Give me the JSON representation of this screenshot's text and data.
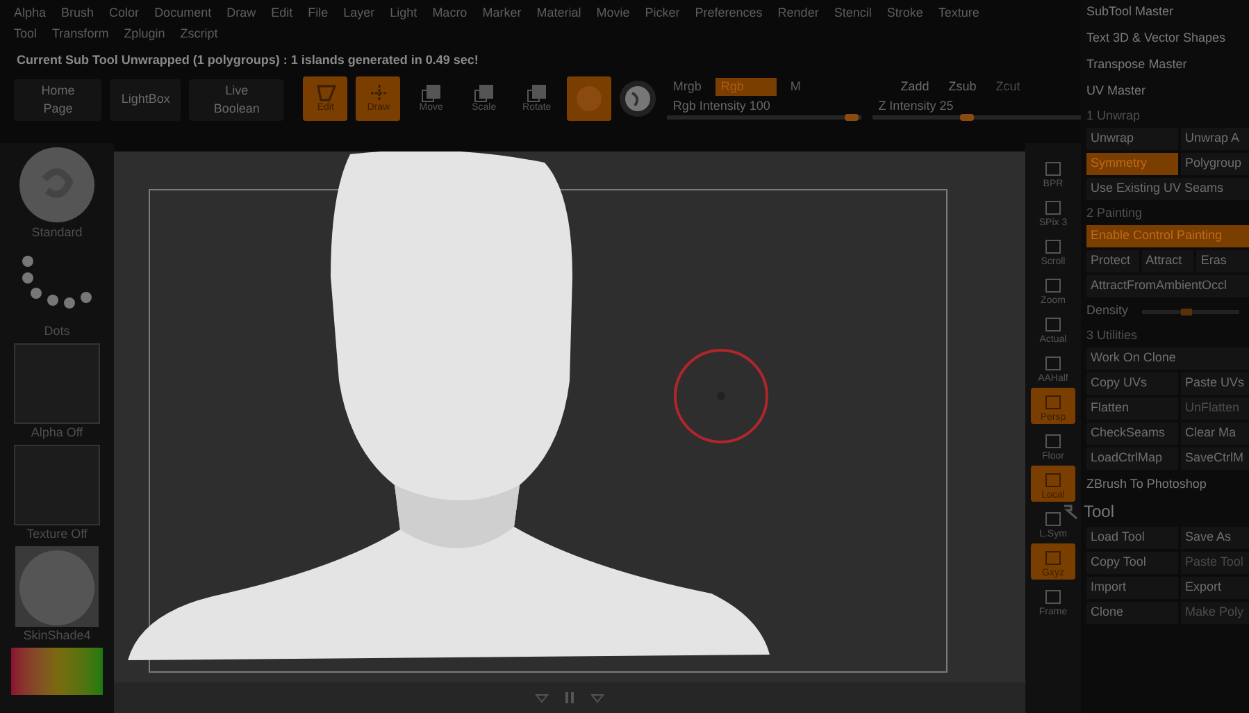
{
  "menu_rows": [
    [
      "Alpha",
      "Brush",
      "Color",
      "Document",
      "Draw",
      "Edit",
      "File",
      "Layer",
      "Light",
      "Macro",
      "Marker",
      "Material",
      "Movie",
      "Picker",
      "Preferences",
      "Render",
      "Stencil",
      "Stroke",
      "Texture"
    ],
    [
      "Tool",
      "Transform",
      "Zplugin",
      "Zscript"
    ]
  ],
  "status_message": "Current Sub Tool Unwrapped (1 polygroups) :  1 islands generated in 0.49 sec!",
  "toolbar": {
    "nav": [
      "Home Page",
      "LightBox",
      "Live Boolean"
    ],
    "tools": [
      {
        "kind": "edit",
        "label": "Edit",
        "selected": true
      },
      {
        "kind": "draw",
        "label": "Draw",
        "selected": true
      },
      {
        "kind": "move",
        "label": "Move",
        "selected": false
      },
      {
        "kind": "scale",
        "label": "Scale",
        "selected": false
      },
      {
        "kind": "rotate",
        "label": "Rotate",
        "selected": false
      },
      {
        "kind": "orb",
        "selected": true
      },
      {
        "kind": "sphere",
        "selected": false
      }
    ],
    "color_modes": [
      {
        "label": "Mrgb",
        "selected": false
      },
      {
        "label": "Rgb",
        "selected": true
      },
      {
        "label": "M",
        "selected": false
      }
    ],
    "z_modes": [
      {
        "label": "Zadd",
        "disabled": false
      },
      {
        "label": "Zsub",
        "disabled": false
      },
      {
        "label": "Zcut",
        "disabled": true
      }
    ],
    "rgb_intensity": {
      "label": "Rgb Intensity 100",
      "level": 0.95
    },
    "z_intensity": {
      "label": "Z Intensity 25",
      "level": 0.45
    }
  },
  "left_shelf": [
    {
      "kind": "brush",
      "label": "Standard"
    },
    {
      "kind": "stroke",
      "label": "Dots"
    },
    {
      "kind": "alpha",
      "label": "Alpha Off"
    },
    {
      "kind": "texture",
      "label": "Texture Off"
    },
    {
      "kind": "material",
      "label": "SkinShade4"
    },
    {
      "kind": "color"
    }
  ],
  "right_strip": [
    {
      "label": "BPR",
      "selected": false
    },
    {
      "label": "SPix 3",
      "selected": false
    },
    {
      "label": "Scroll",
      "selected": false
    },
    {
      "label": "Zoom",
      "selected": false
    },
    {
      "label": "Actual",
      "selected": false
    },
    {
      "label": "AAHalf",
      "selected": false
    },
    {
      "label": "Persp",
      "selected": true
    },
    {
      "label": "Floor",
      "selected": false
    },
    {
      "label": "Local",
      "selected": true
    },
    {
      "label": "L.Sym",
      "selected": false
    },
    {
      "label": "Gxyz",
      "selected": true
    },
    {
      "label": "Frame",
      "selected": false
    }
  ],
  "right_panel": [
    {
      "kind": "plain",
      "label": "SubTool Master"
    },
    {
      "kind": "plain",
      "label": "Text 3D & Vector Shapes"
    },
    {
      "kind": "plain",
      "label": "Transpose Master"
    },
    {
      "kind": "plain",
      "label": "UV Master"
    },
    {
      "kind": "header",
      "label": "1 Unwrap"
    },
    {
      "kind": "buttons",
      "buttons": [
        {
          "label": "Unwrap",
          "selected": false,
          "disabled": false
        },
        {
          "label": "Unwrap A",
          "selected": false,
          "disabled": false
        }
      ]
    },
    {
      "kind": "buttons",
      "buttons": [
        {
          "label": "Symmetry",
          "selected": true,
          "disabled": false
        },
        {
          "label": "Polygroup",
          "selected": false,
          "disabled": false
        }
      ]
    },
    {
      "kind": "buttons",
      "buttons": [
        {
          "label": "Use Existing UV Seams",
          "selected": false,
          "disabled": false
        }
      ]
    },
    {
      "kind": "header",
      "label": "2 Painting"
    },
    {
      "kind": "buttons",
      "buttons": [
        {
          "label": "Enable Control Painting",
          "selected": true,
          "disabled": false
        }
      ]
    },
    {
      "kind": "buttons",
      "buttons": [
        {
          "label": "Protect",
          "selected": false,
          "disabled": false
        },
        {
          "label": "Attract",
          "selected": false,
          "disabled": false
        },
        {
          "label": "Eras",
          "selected": false,
          "disabled": false
        }
      ]
    },
    {
      "kind": "buttons",
      "buttons": [
        {
          "label": "AttractFromAmbientOccl",
          "selected": false,
          "disabled": false
        }
      ]
    },
    {
      "kind": "slider",
      "label": "Density",
      "level": 0.45
    },
    {
      "kind": "header",
      "label": "3 Utilities"
    },
    {
      "kind": "buttons",
      "buttons": [
        {
          "label": "Work On Clone",
          "selected": false,
          "disabled": false
        }
      ]
    },
    {
      "kind": "buttons",
      "buttons": [
        {
          "label": "Copy UVs",
          "selected": false,
          "disabled": false
        },
        {
          "label": "Paste UVs",
          "selected": false,
          "disabled": false
        }
      ]
    },
    {
      "kind": "buttons",
      "buttons": [
        {
          "label": "Flatten",
          "selected": false,
          "disabled": false
        },
        {
          "label": "UnFlatten",
          "selected": false,
          "disabled": true
        }
      ]
    },
    {
      "kind": "buttons",
      "buttons": [
        {
          "label": "CheckSeams",
          "selected": false,
          "disabled": false
        },
        {
          "label": "Clear Ma",
          "selected": false,
          "disabled": false
        }
      ]
    },
    {
      "kind": "buttons",
      "buttons": [
        {
          "label": "LoadCtrlMap",
          "selected": false,
          "disabled": false
        },
        {
          "label": "SaveCtrlM",
          "selected": false,
          "disabled": false
        }
      ]
    },
    {
      "kind": "plain",
      "label": "ZBrush To Photoshop"
    },
    {
      "kind": "section",
      "label": "Tool"
    },
    {
      "kind": "buttons",
      "buttons": [
        {
          "label": "Load Tool",
          "selected": false,
          "disabled": false
        },
        {
          "label": "Save As",
          "selected": false,
          "disabled": false
        }
      ]
    },
    {
      "kind": "buttons",
      "buttons": [
        {
          "label": "Copy Tool",
          "selected": false,
          "disabled": false
        },
        {
          "label": "Paste Tool",
          "selected": false,
          "disabled": true
        }
      ]
    },
    {
      "kind": "buttons",
      "buttons": [
        {
          "label": "Import",
          "selected": false,
          "disabled": false
        },
        {
          "label": "Export",
          "selected": false,
          "disabled": false
        }
      ]
    },
    {
      "kind": "buttons",
      "buttons": [
        {
          "label": "Clone",
          "selected": false,
          "disabled": false
        },
        {
          "label": "Make Poly",
          "selected": false,
          "disabled": true
        }
      ]
    }
  ]
}
